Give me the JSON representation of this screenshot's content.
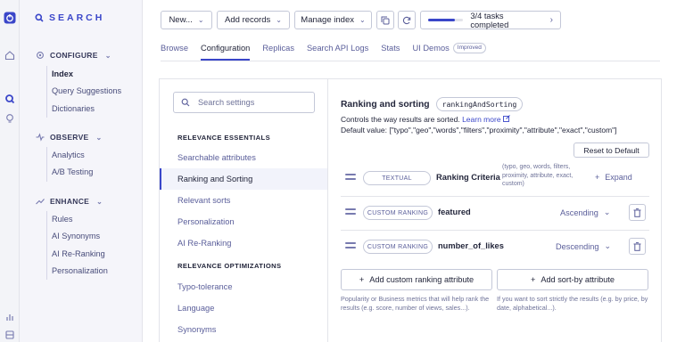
{
  "brand": {
    "name": "SEARCH"
  },
  "sidebar": {
    "sections": [
      {
        "label": "CONFIGURE",
        "icon": "gear-icon",
        "items": [
          "Index",
          "Query Suggestions",
          "Dictionaries"
        ],
        "active": "Index"
      },
      {
        "label": "OBSERVE",
        "icon": "pulse-icon",
        "items": [
          "Analytics",
          "A/B Testing"
        ]
      },
      {
        "label": "ENHANCE",
        "icon": "trend-icon",
        "items": [
          "Rules",
          "AI Synonyms",
          "AI Re-Ranking",
          "Personalization"
        ]
      }
    ]
  },
  "toolbar": {
    "new_label": "New...",
    "add_records_label": "Add records",
    "manage_index_label": "Manage index",
    "tasks_label": "3/4 tasks completed",
    "tasks_progress": 0.75
  },
  "tabs": [
    "Browse",
    "Configuration",
    "Replicas",
    "Search API Logs",
    "Stats",
    "UI Demos"
  ],
  "tabs_badge": "Improved",
  "active_tab": "Configuration",
  "settings": {
    "search_placeholder": "Search settings",
    "group1": "RELEVANCE ESSENTIALS",
    "group1_items": [
      "Searchable attributes",
      "Ranking and Sorting",
      "Relevant sorts",
      "Personalization",
      "AI Re-Ranking"
    ],
    "group2": "RELEVANCE OPTIMIZATIONS",
    "group2_items": [
      "Typo-tolerance",
      "Language",
      "Synonyms"
    ],
    "active": "Ranking and Sorting"
  },
  "detail": {
    "title": "Ranking and sorting",
    "code": "rankingAndSorting",
    "desc": "Controls the way results are sorted.",
    "learn_more": "Learn more",
    "default_value": "Default value: [\"typo\",\"geo\",\"words\",\"filters\",\"proximity\",\"attribute\",\"exact\",\"custom\"]",
    "reset_label": "Reset to Default",
    "rows": [
      {
        "tag": "TEXTUAL",
        "name": "Ranking Criteria",
        "help": "(typo, geo, words, filters, proximity, attribute, exact, custom)",
        "action": "Expand"
      },
      {
        "tag": "CUSTOM RANKING",
        "name": "featured",
        "order": "Ascending"
      },
      {
        "tag": "CUSTOM RANKING",
        "name": "number_of_likes",
        "order": "Descending"
      }
    ],
    "add_custom_label": "Add custom ranking attribute",
    "add_sort_label": "Add sort-by attribute",
    "add_custom_help": "Popularity or Business metrics that will help rank the results (e.g. score, number of views, sales...).",
    "add_sort_help": "If you want to sort strictly the results (e.g. by price, by date, alphabetical...)."
  },
  "colors": {
    "accent": "#3a46c9",
    "text": "#23263b",
    "muted": "#5a5e9a",
    "border": "#c4c8d8"
  }
}
